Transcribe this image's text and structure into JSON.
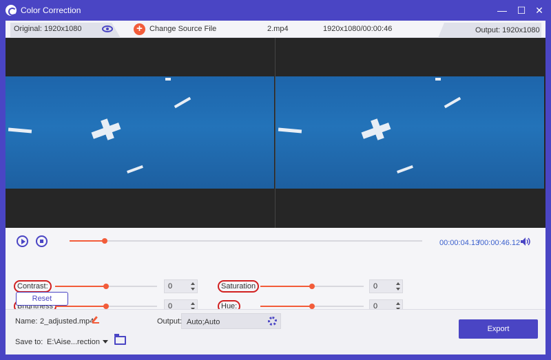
{
  "window": {
    "title": "Color Correction"
  },
  "infobar": {
    "original_label": "Original: 1920x1080",
    "change_source_label": "Change Source File",
    "file_name": "2.mp4",
    "file_info": "1920x1080/00:00:46",
    "output_label": "Output: 1920x1080"
  },
  "playback": {
    "current_time": "00:00:04.13",
    "total_time": "/00:00:46.12",
    "progress": 0.1
  },
  "adjustments": {
    "contrast": {
      "label": "Contrast:",
      "value": "0",
      "level": 0.5
    },
    "brightness": {
      "label": "Brightness",
      "value": "0",
      "level": 0.5
    },
    "saturation": {
      "label": "Saturation",
      "value": "0",
      "level": 0.5
    },
    "hue": {
      "label": "Hue:",
      "value": "0",
      "level": 0.5
    },
    "reset_label": "Reset"
  },
  "bottom": {
    "name_label": "Name:",
    "name_value": "2_adjusted.mp4",
    "output_label": "Output:",
    "output_value": "Auto;Auto",
    "saveto_label": "Save to:",
    "saveto_value": "E:\\Aise...rection",
    "export_label": "Export"
  },
  "colors": {
    "accent": "#4a45c4",
    "slider": "#f25c3a",
    "sky": "#1d65ab"
  }
}
